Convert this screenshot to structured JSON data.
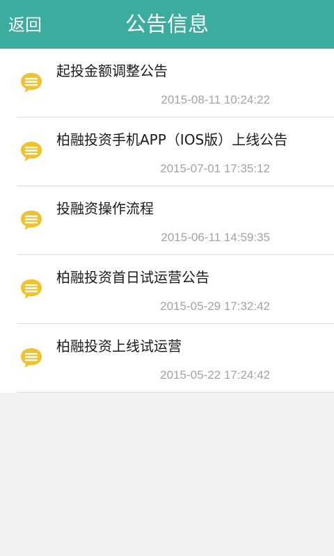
{
  "header": {
    "back_label": "返回",
    "title": "公告信息",
    "background_color": "#3aad9e"
  },
  "notices": [
    {
      "title": "起投金额调整公告",
      "time": "2015-08-11 10:24:22",
      "icon": "message-bubble-icon"
    },
    {
      "title": "柏融投资手机APP（IOS版）上线公告",
      "time": "2015-07-01 17:35:12",
      "icon": "message-bubble-icon"
    },
    {
      "title": "投融资操作流程",
      "time": "2015-06-11 14:59:35",
      "icon": "message-bubble-icon"
    },
    {
      "title": "柏融投资首日试运营公告",
      "time": "2015-05-29 17:32:42",
      "icon": "message-bubble-icon"
    },
    {
      "title": "柏融投资上线试运营",
      "time": "2015-05-22 17:24:42",
      "icon": "message-bubble-icon"
    }
  ],
  "colors": {
    "icon_fill": "#f2c12e",
    "icon_lines": "#ffffff",
    "time_text": "#a3a3a3"
  }
}
